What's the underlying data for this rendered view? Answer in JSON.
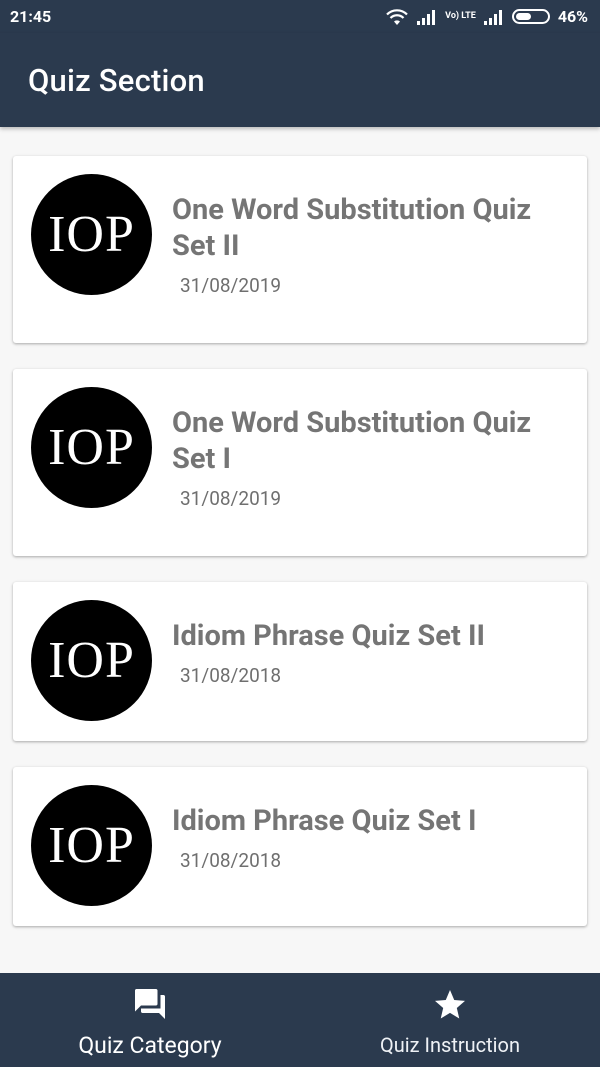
{
  "status_bar": {
    "time": "21:45",
    "lte_label": "Vo) LTE",
    "battery": "46%"
  },
  "app_bar": {
    "title": "Quiz Section"
  },
  "quizzes": [
    {
      "logo_text": "IOP",
      "title": "One Word Substitution Quiz Set II",
      "date": "31/08/2019"
    },
    {
      "logo_text": "IOP",
      "title": "One Word Substitution Quiz Set I",
      "date": "31/08/2019"
    },
    {
      "logo_text": "IOP",
      "title": "Idiom Phrase Quiz Set II",
      "date": "31/08/2018"
    },
    {
      "logo_text": "IOP",
      "title": "Idiom Phrase Quiz Set I",
      "date": "31/08/2018"
    }
  ],
  "bottom_nav": {
    "category": {
      "label": "Quiz Category",
      "icon": "forum-icon"
    },
    "instruction": {
      "label": "Quiz Instruction",
      "icon": "star-icon"
    }
  },
  "colors": {
    "primary": "#2b3a4e",
    "title_text": "#757575",
    "background": "#f7f7f7"
  }
}
